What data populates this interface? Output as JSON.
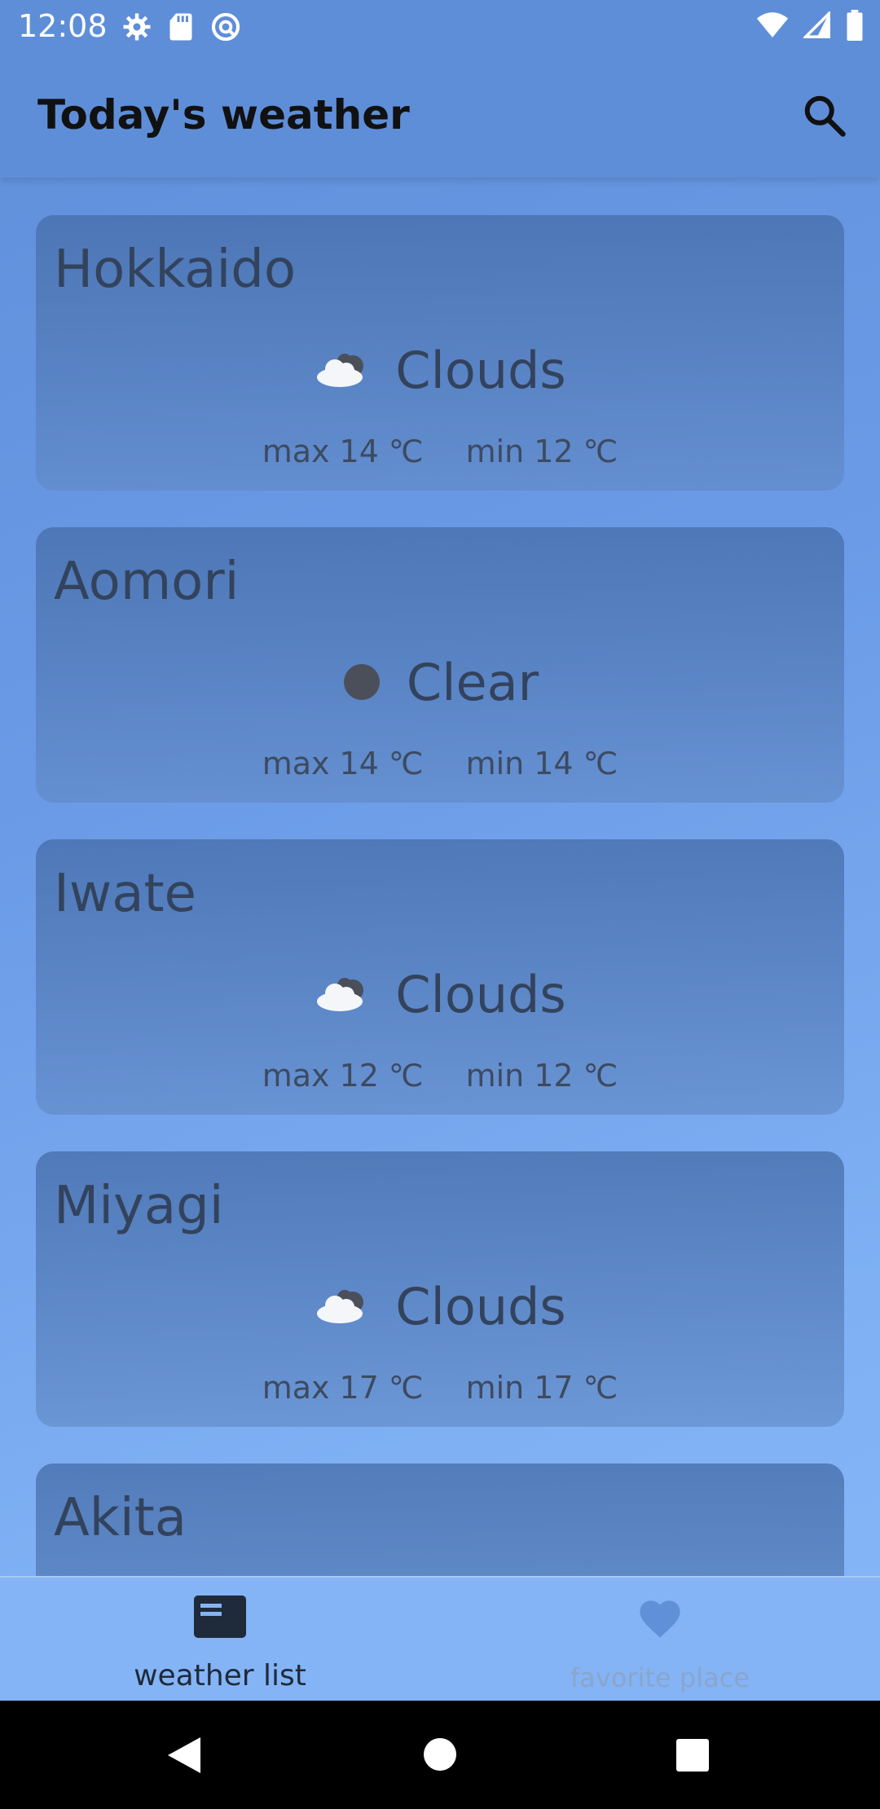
{
  "status": {
    "time": "12:08",
    "left_icons": [
      "settings-icon",
      "sd-card-icon",
      "sync-icon"
    ],
    "right_icons": [
      "wifi-icon",
      "signal-icon",
      "battery-icon"
    ]
  },
  "app_bar": {
    "title": "Today's weather",
    "search_icon": "search-icon"
  },
  "cards": [
    {
      "place": "Hokkaido",
      "condition": "Clouds",
      "icon": "cloud-icon",
      "max_label": "max",
      "max": "14",
      "unit": "℃",
      "min_label": "min",
      "min": "12"
    },
    {
      "place": "Aomori",
      "condition": "Clear",
      "icon": "clear-icon",
      "max_label": "max",
      "max": "14",
      "unit": "℃",
      "min_label": "min",
      "min": "14"
    },
    {
      "place": "Iwate",
      "condition": "Clouds",
      "icon": "cloud-icon",
      "max_label": "max",
      "max": "12",
      "unit": "℃",
      "min_label": "min",
      "min": "12"
    },
    {
      "place": "Miyagi",
      "condition": "Clouds",
      "icon": "cloud-icon",
      "max_label": "max",
      "max": "17",
      "unit": "℃",
      "min_label": "min",
      "min": "17"
    },
    {
      "place": "Akita"
    }
  ],
  "bottom_nav": {
    "items": [
      {
        "label": "weather list",
        "icon": "article-icon",
        "active": true
      },
      {
        "label": "favorite place",
        "icon": "heart-icon",
        "active": false
      }
    ]
  },
  "system_nav": [
    "back-icon",
    "home-icon",
    "recents-icon"
  ],
  "colors": {
    "app_bar": "#5f8ed8",
    "card_text": "#33435d",
    "bottom_nav": "#84b4f5"
  }
}
